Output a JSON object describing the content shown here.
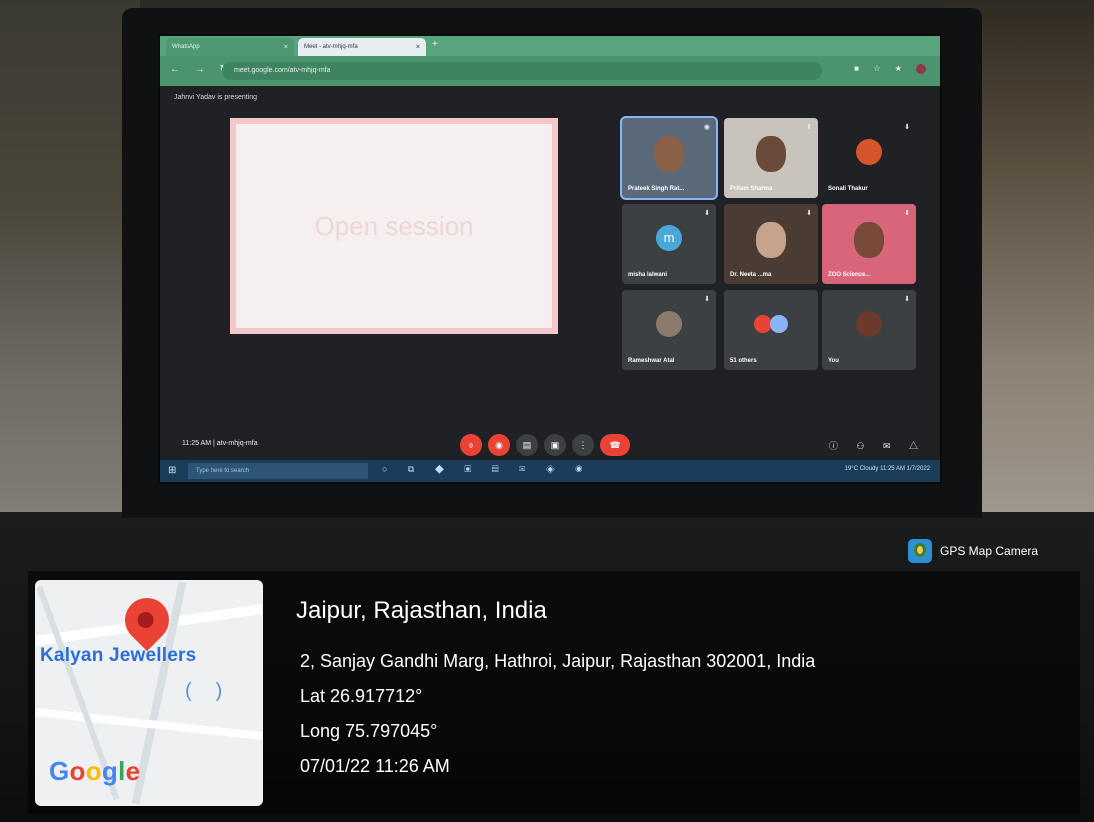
{
  "browser": {
    "tabs": [
      {
        "label": "WhatsApp"
      },
      {
        "label": "Meet - atv-mhjq-mfa"
      }
    ],
    "url": "meet.google.com/atv-mhjq-mfa"
  },
  "meet": {
    "presenting_text": "Jahnvi Yadav is presenting",
    "slide_text": "Open session",
    "participants": [
      {
        "name": "Prateek Singh Rat..."
      },
      {
        "name": "Pritam Sharma"
      },
      {
        "name": "Sonali Thakur"
      },
      {
        "name": "misha lalwani",
        "initial": "m"
      },
      {
        "name": "Dr. Neeta ...ma"
      },
      {
        "name": "ZOO Science..."
      },
      {
        "name": "Rameshwar Atal"
      },
      {
        "name": "51 others"
      },
      {
        "name": "You"
      }
    ],
    "time_code": "11:25 AM | atv-mhjq-mfa"
  },
  "taskbar": {
    "search_placeholder": "Type here to search",
    "weather": "19°C Cloudy",
    "clock": "11:25 AM 1/7/2022"
  },
  "overlay": {
    "badge_label": "GPS Map Camera",
    "map_place": "Kalyan Jewellers",
    "map_brand": "Google",
    "location_title": "Jaipur, Rajasthan, India",
    "address": "2, Sanjay Gandhi Marg, Hathroi, Jaipur, Rajasthan 302001, India",
    "lat": "Lat 26.917712°",
    "long": "Long 75.797045°",
    "datetime": "07/01/22 11:26 AM"
  },
  "colors": {
    "meet_red": "#ea4335",
    "tile_gray": "#3c4043",
    "map_blue": "#2a6fd6"
  }
}
